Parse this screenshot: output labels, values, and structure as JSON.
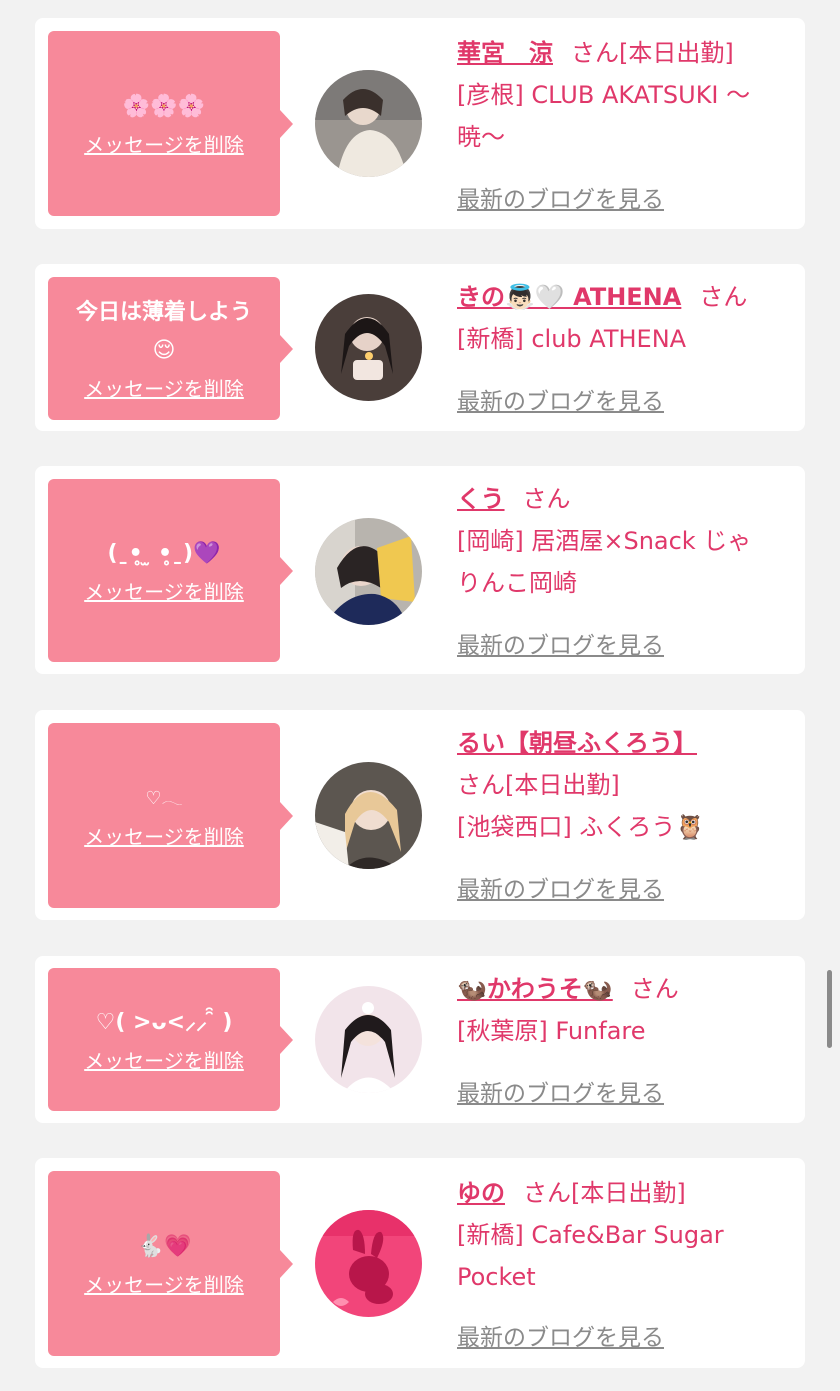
{
  "delete_label": "メッセージを削除",
  "blog_label": "最新のブログを見る",
  "san_label": "さん",
  "colors": {
    "accent": "#e0386a",
    "bubble": "#f7899a",
    "link_gray": "#8a8a8a",
    "background": "#f2f2f2"
  },
  "cards": [
    {
      "message": "🌸🌸🌸",
      "name": "華宮　涼",
      "suffix": "[本日出勤]",
      "shop_lines": [
        "[彦根] CLUB AKATSUKI 〜",
        "暁〜"
      ],
      "avatar_icon": "avatar-photo"
    },
    {
      "message": "今日は薄着しよう\n😌",
      "name": "きの👼🏻🤍 ATHENA",
      "suffix": "",
      "shop_lines": [
        "[新橋] club ATHENA"
      ],
      "avatar_icon": "avatar-photo"
    },
    {
      "message": "(ˍ•̥ ̫ •̥ˍ)💜",
      "name": "くう",
      "suffix": "",
      "shop_lines": [
        "[岡崎] 居酒屋×Snack じゃ",
        "りんこ岡崎"
      ],
      "avatar_icon": "avatar-photo"
    },
    {
      "message": "♡𓂃",
      "name": "るい【朝昼ふくろう】",
      "suffix": "[本日出勤]",
      "shop_lines": [
        "[池袋西口] ふくろう🦉"
      ],
      "avatar_icon": "avatar-photo"
    },
    {
      "message": "♡( >ᴗ<⸝⸝ ̑̑ )",
      "name": "🦦かわうそ🦦",
      "suffix": "",
      "shop_lines": [
        "[秋葉原] Funfare"
      ],
      "avatar_icon": "avatar-photo"
    },
    {
      "message": "🐇💗",
      "name": "ゆの",
      "suffix": "[本日出勤]",
      "shop_lines": [
        "[新橋] Cafe&Bar Sugar",
        "Pocket"
      ],
      "avatar_icon": "rabbit-logo-avatar"
    }
  ]
}
